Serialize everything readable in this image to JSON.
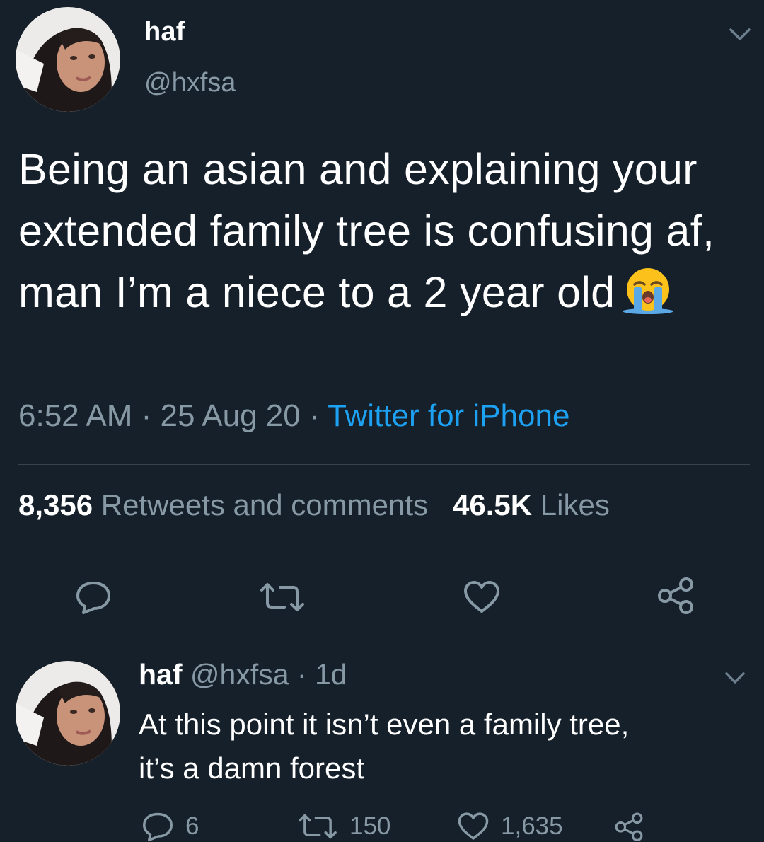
{
  "tweet": {
    "display_name": "haf",
    "handle": "@hxfsa",
    "text": "Being an asian and explaining your extended family tree is confusing af, man I’m a niece to a 2 year old",
    "emoji": "loudly-crying-face",
    "time": "6:52 AM",
    "date": "25 Aug 20",
    "separator": " · ",
    "source": "Twitter for iPhone",
    "retweets_count": "8,356",
    "retweets_label": "Retweets and comments",
    "likes_count": "46.5K",
    "likes_label": "Likes",
    "actions": [
      "reply-icon",
      "retweet-icon",
      "like-icon",
      "share-icon"
    ]
  },
  "reply": {
    "display_name": "haf",
    "handle": "@hxfsa",
    "age": "1d",
    "separator": " · ",
    "text_line1": "At this point it isn’t even a family tree,",
    "text_line2": "it’s a damn forest",
    "reply_count": "6",
    "retweet_count": "150",
    "like_count": "1,635"
  },
  "colors": {
    "background": "#15202b",
    "primary_text": "#ffffff",
    "secondary_text": "#8899a6",
    "link": "#1da1f2",
    "divider": "#38444d"
  }
}
